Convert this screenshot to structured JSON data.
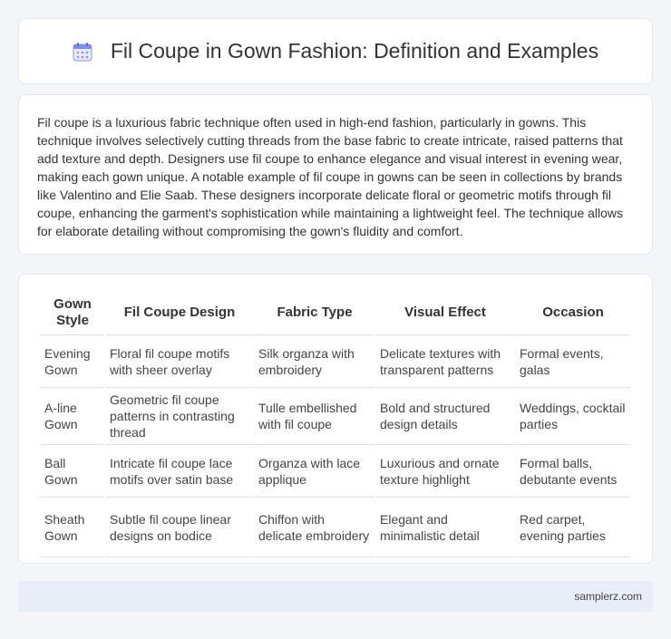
{
  "header": {
    "title": "Fil Coupe in Gown Fashion: Definition and Examples",
    "icon": "calendar-icon"
  },
  "intro": {
    "text": "Fil coupe is a luxurious fabric technique often used in high-end fashion, particularly in gowns. This technique involves selectively cutting threads from the base fabric to create intricate, raised patterns that add texture and depth. Designers use fil coupe to enhance elegance and visual interest in evening wear, making each gown unique. A notable example of fil coupe in gowns can be seen in collections by brands like Valentino and Elie Saab. These designers incorporate delicate floral or geometric motifs through fil coupe, enhancing the garment's sophistication while maintaining a lightweight feel. The technique allows for elaborate detailing without compromising the gown's fluidity and comfort."
  },
  "table": {
    "headers": [
      "Gown Style",
      "Fil Coupe Design",
      "Fabric Type",
      "Visual Effect",
      "Occasion"
    ],
    "rows": [
      [
        "Evening Gown",
        "Floral fil coupe motifs with sheer overlay",
        "Silk organza with embroidery",
        "Delicate textures with transparent patterns",
        "Formal events, galas"
      ],
      [
        "A-line Gown",
        "Geometric fil coupe patterns in contrasting thread",
        "Tulle embellished with fil coupe",
        "Bold and structured design details",
        "Weddings, cocktail parties"
      ],
      [
        "Ball Gown",
        "Intricate fil coupe lace motifs over satin base",
        "Organza with lace applique",
        "Luxurious and ornate texture highlight",
        "Formal balls, debutante events"
      ],
      [
        "Sheath Gown",
        "Subtle fil coupe linear designs on bodice",
        "Chiffon with delicate embroidery",
        "Elegant and minimalistic detail",
        "Red carpet, evening parties"
      ]
    ]
  },
  "footer": {
    "site": "samplerz.com"
  }
}
